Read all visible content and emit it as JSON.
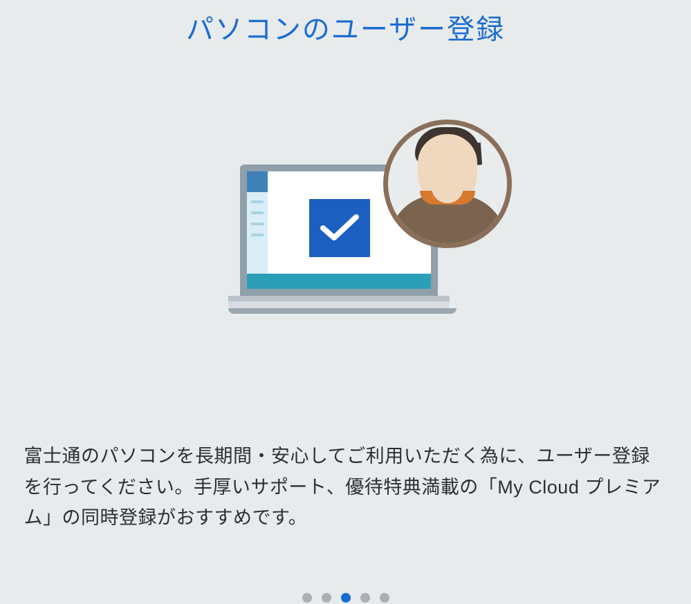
{
  "title": "パソコンのユーザー登録",
  "description": "富士通のパソコンを長期間・安心してご利用いただく為に、ユーザー登録を行ってください。手厚いサポート、優待特典満載の「My Cloud プレミアム」の同時登録がおすすめです。",
  "illustration": {
    "laptop_icon": "laptop-with-checkmark",
    "avatar_icon": "user-avatar"
  },
  "colors": {
    "accent": "#1a6dd0",
    "text": "#2b2f31",
    "background": "#e8ebec"
  },
  "pagination": {
    "total": 5,
    "active_index": 2
  }
}
